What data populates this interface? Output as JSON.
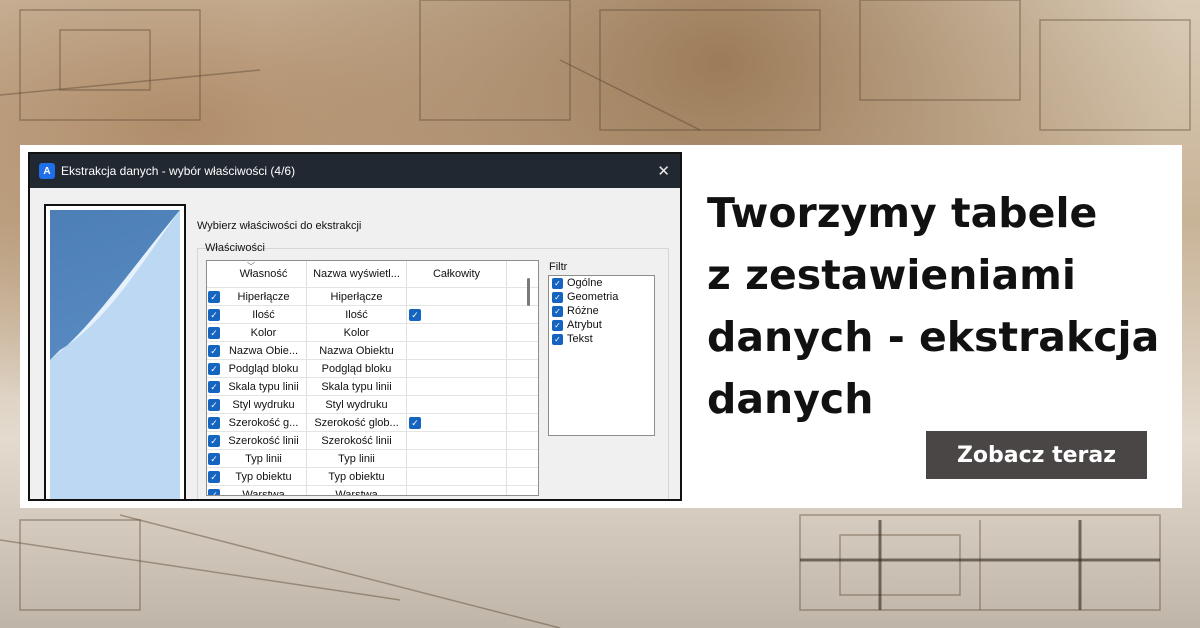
{
  "dialog": {
    "title": "Ekstrakcja danych - wybór właściwości (4/6)",
    "close_glyph": "✕",
    "app_icon": "app-icon",
    "prompt": "Wybierz właściwości do ekstrakcji",
    "group_label": "Właściwości",
    "columns": [
      "Własność",
      "Nazwa wyświetl...",
      "Całkowity"
    ],
    "rows": [
      {
        "checked": true,
        "property": "Hiperłącze",
        "display": "Hiperłącze",
        "total": false
      },
      {
        "checked": true,
        "property": "Ilość",
        "display": "Ilość",
        "total": true
      },
      {
        "checked": true,
        "property": "Kolor",
        "display": "Kolor",
        "total": false
      },
      {
        "checked": true,
        "property": "Nazwa Obie...",
        "display": "Nazwa Obiektu",
        "total": false
      },
      {
        "checked": true,
        "property": "Podgląd bloku",
        "display": "Podgląd bloku",
        "total": false
      },
      {
        "checked": true,
        "property": "Skala typu linii",
        "display": "Skala typu linii",
        "total": false
      },
      {
        "checked": true,
        "property": "Styl wydruku",
        "display": "Styl wydruku",
        "total": false
      },
      {
        "checked": true,
        "property": "Szerokość g...",
        "display": "Szerokość glob...",
        "total": true
      },
      {
        "checked": true,
        "property": "Szerokość linii",
        "display": "Szerokość linii",
        "total": false
      },
      {
        "checked": true,
        "property": "Typ linii",
        "display": "Typ linii",
        "total": false
      },
      {
        "checked": true,
        "property": "Typ obiektu",
        "display": "Typ obiektu",
        "total": false
      },
      {
        "checked": true,
        "property": "Warstwa",
        "display": "Warstwa",
        "total": false
      }
    ],
    "filter": {
      "label": "Filtr",
      "items": [
        {
          "label": "Ogólne",
          "checked": true
        },
        {
          "label": "Geometria",
          "checked": true
        },
        {
          "label": "Różne",
          "checked": true
        },
        {
          "label": "Atrybut",
          "checked": true
        },
        {
          "label": "Tekst",
          "checked": true
        }
      ]
    }
  },
  "headline": {
    "line1": "Tworzymy tabele",
    "line2": "z zestawieniami",
    "line3": "danych - ekstrakcja",
    "line4": "danych"
  },
  "cta": {
    "label": "Zobacz teraz"
  },
  "colors": {
    "accent_checkbox": "#1565c0",
    "titlebar": "#222831",
    "cta_bg": "#4b4646"
  }
}
